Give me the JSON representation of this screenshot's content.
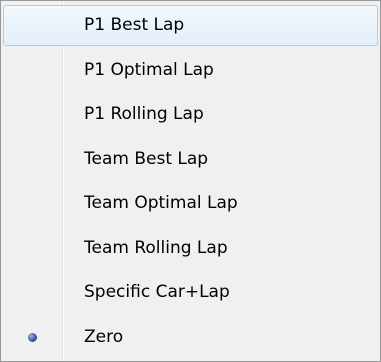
{
  "menu": {
    "items": [
      {
        "label": "P1 Best Lap",
        "selected": false,
        "hover": true
      },
      {
        "label": "P1 Optimal Lap",
        "selected": false,
        "hover": false
      },
      {
        "label": "P1 Rolling Lap",
        "selected": false,
        "hover": false
      },
      {
        "label": "Team Best Lap",
        "selected": false,
        "hover": false
      },
      {
        "label": "Team Optimal Lap",
        "selected": false,
        "hover": false
      },
      {
        "label": "Team Rolling Lap",
        "selected": false,
        "hover": false
      },
      {
        "label": "Specific Car+Lap",
        "selected": false,
        "hover": false
      },
      {
        "label": "Zero",
        "selected": true,
        "hover": false
      }
    ],
    "selected_indicator_icon": "radio-bullet-icon",
    "colors": {
      "hover_border": "#a8cff2",
      "radio_bullet": "#3b57a8"
    }
  }
}
